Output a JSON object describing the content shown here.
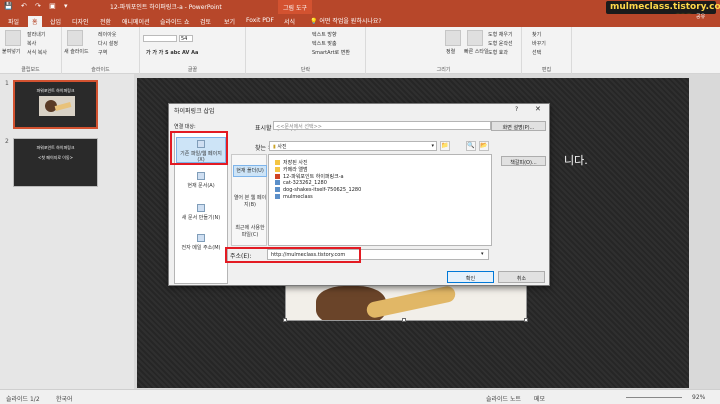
{
  "titlebar": {
    "quick_access": "💾 ↶ ↷ ▣ ▾",
    "document_title": "12-파워포인트 하이퍼링크-a - PowerPoint",
    "context_tab": "그림 도구"
  },
  "watermark": {
    "text": "mulmeclass.tistory.com",
    "logo": "MC"
  },
  "tabs": [
    {
      "label": "파일"
    },
    {
      "label": "홈"
    },
    {
      "label": "삽입"
    },
    {
      "label": "디자인"
    },
    {
      "label": "전환"
    },
    {
      "label": "애니메이션"
    },
    {
      "label": "슬라이드 쇼"
    },
    {
      "label": "검토"
    },
    {
      "label": "보기"
    },
    {
      "label": "Foxit PDF"
    },
    {
      "label": "서식"
    }
  ],
  "tell_me": "어떤 작업을 원하시나요?",
  "share": "공유",
  "ribbon": {
    "paste_label": "붙여넣기",
    "clipboard_items": [
      "잘라내기",
      "복사",
      "서식 복사"
    ],
    "new_slide_label": "새 슬라이드",
    "slide_items": [
      "레이아웃",
      "다시 설정",
      "구역"
    ],
    "font_size": "54",
    "groups": [
      "클립보드",
      "슬라이드",
      "글꼴",
      "단락",
      "그리기",
      "편집"
    ],
    "paragraph_items": [
      "텍스트 방향",
      "텍스트 맞춤",
      "SmartArt로 변환"
    ],
    "arrange_label": "정렬",
    "quick_style_label": "빠른 스타일",
    "shape_items": [
      "도형 채우기",
      "도형 윤곽선",
      "도형 효과"
    ],
    "edit_items": [
      "찾기",
      "바꾸기",
      "선택"
    ]
  },
  "thumbnails": [
    {
      "number": "1",
      "title": "파워포인트 하이퍼링크"
    },
    {
      "number": "2",
      "title": "파워포인트 하이퍼링크",
      "subtitle": "<첫 페이지로 이동>"
    }
  ],
  "slide": {
    "visible_text": "니다."
  },
  "dialog": {
    "title": "하이퍼링크 삽입",
    "help": "?",
    "close": "✕",
    "link_to_label": "연결 대상:",
    "link_to_items": [
      {
        "label": "기존 파일/웹 페이지(X)",
        "icon": "globe-file-icon"
      },
      {
        "label": "현재 문서(A)",
        "icon": "document-icon"
      },
      {
        "label": "새 문서 만들기(N)",
        "icon": "new-document-icon"
      },
      {
        "label": "전자 메일 주소(M)",
        "icon": "email-icon"
      }
    ],
    "display_text_label": "표시할 텍스트(I):",
    "display_text_value": "<<문서에서 선택>>",
    "screentip_button": "화면 설명(P)...",
    "look_in_label": "찾는 위치(L):",
    "look_in_value": "사진",
    "bookmark_button": "책갈피(O)...",
    "nav_items": [
      "현재 폴더(U)",
      "열어 본 웹 페이지(B)",
      "최근에 사용한 파일(C)"
    ],
    "files": [
      {
        "name": "저장된 사진",
        "type": "folder"
      },
      {
        "name": "카메라 앨범",
        "type": "folder"
      },
      {
        "name": "12-파워포인트 하이퍼링크-a",
        "type": "ppt"
      },
      {
        "name": "cat-323262_1280",
        "type": "img"
      },
      {
        "name": "dog-shakes-itself-750625_1280",
        "type": "img"
      },
      {
        "name": "mulmeclass",
        "type": "img"
      }
    ],
    "address_label": "주소(E):",
    "address_value": "http://mulmeclass.tistory.com",
    "ok_button": "확인",
    "cancel_button": "취소"
  },
  "statusbar": {
    "slide_info": "슬라이드 1/2",
    "language": "한국어",
    "notes": "슬라이드 노트",
    "comments": "메모",
    "zoom": "92%"
  },
  "colors": {
    "accent": "#b7472a",
    "highlight_box": "#e31b23"
  }
}
